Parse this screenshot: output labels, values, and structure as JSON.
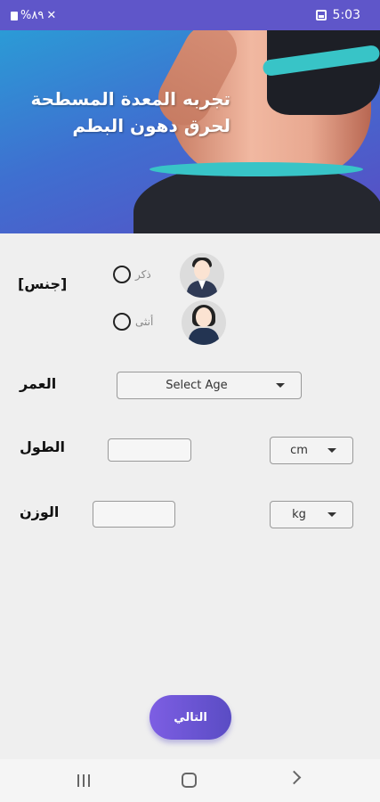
{
  "status_bar": {
    "left_text": "%٨٩",
    "time": "5:03"
  },
  "banner": {
    "title_line1": "تجربه المعدة المسطحة",
    "title_line2": "لحرق دهون البطم"
  },
  "gender": {
    "label": "[جنس]",
    "options": [
      {
        "label": "ذكر"
      },
      {
        "label": "أنثى"
      }
    ]
  },
  "age": {
    "label": "العمر",
    "select_value": "Select Age"
  },
  "height": {
    "label": "الطول",
    "input_value": "",
    "unit_value": "cm"
  },
  "weight": {
    "label": "الوزن",
    "input_value": "",
    "unit_value": "kg"
  },
  "next_button": {
    "label": "التالي"
  },
  "colors": {
    "status_bar": "#5f56c9",
    "accent": "#5a4cc4",
    "banner_start": "#2b9bd6"
  }
}
